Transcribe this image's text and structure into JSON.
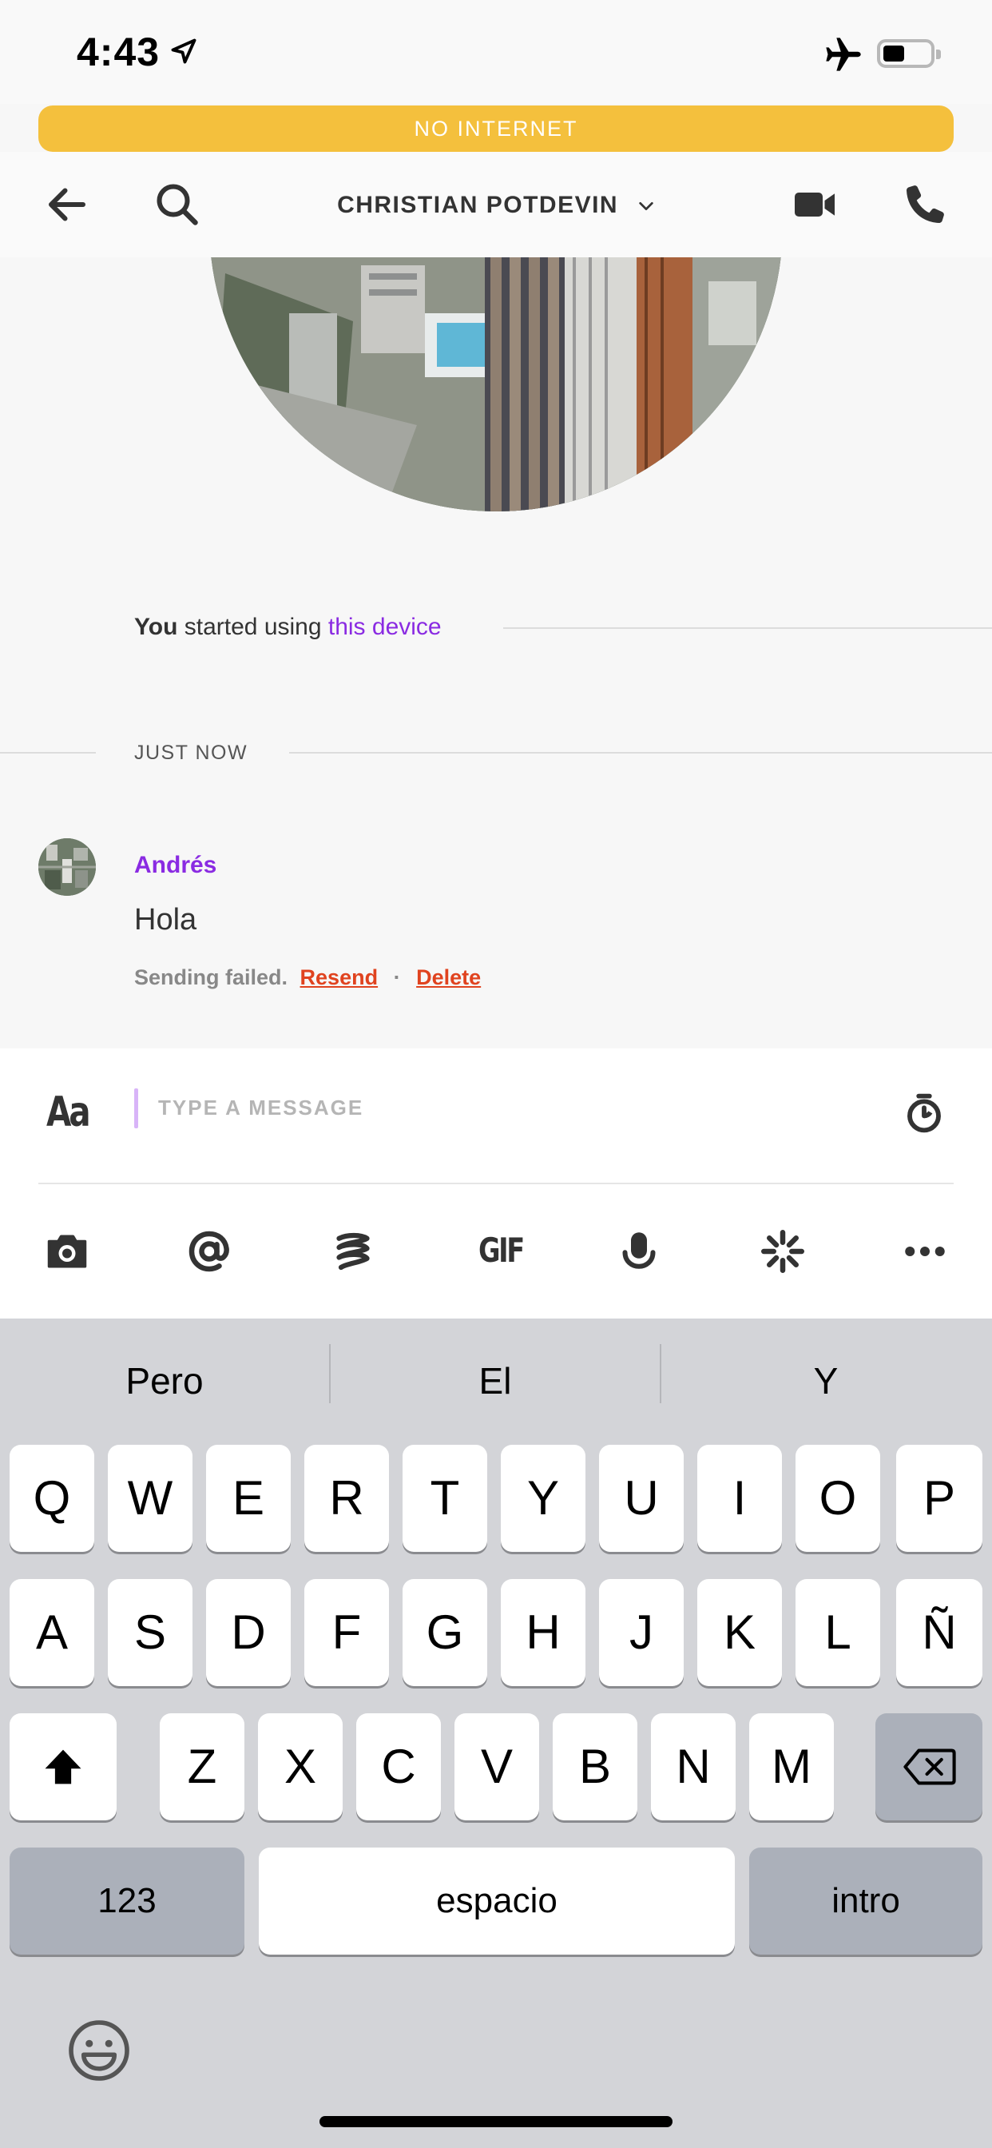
{
  "status_bar": {
    "time": "4:43"
  },
  "banner": {
    "text": "NO INTERNET"
  },
  "header": {
    "title": "CHRISTIAN POTDEVIN"
  },
  "conversation": {
    "system_message": {
      "actor": "You",
      "text": " started using ",
      "link": "this device"
    },
    "date_separator": "JUST NOW",
    "message": {
      "sender": "Andrés",
      "text": "Hola",
      "failed_text": "Sending failed.",
      "resend": "Resend",
      "separator": "·",
      "delete": "Delete"
    }
  },
  "composer": {
    "format_label": "Aa",
    "placeholder": "TYPE A MESSAGE",
    "gif_label": "GIF"
  },
  "keyboard": {
    "suggestions": [
      "Pero",
      "El",
      "Y"
    ],
    "row1": [
      "Q",
      "W",
      "E",
      "R",
      "T",
      "Y",
      "U",
      "I",
      "O",
      "P"
    ],
    "row2": [
      "A",
      "S",
      "D",
      "F",
      "G",
      "H",
      "J",
      "K",
      "L",
      "Ñ"
    ],
    "row3": [
      "Z",
      "X",
      "C",
      "V",
      "B",
      "N",
      "M"
    ],
    "numbers_label": "123",
    "space_label": "espacio",
    "return_label": "intro"
  },
  "colors": {
    "banner": "#f4c03d",
    "accent_purple": "#8a2be2",
    "error_red": "#e0431f"
  }
}
